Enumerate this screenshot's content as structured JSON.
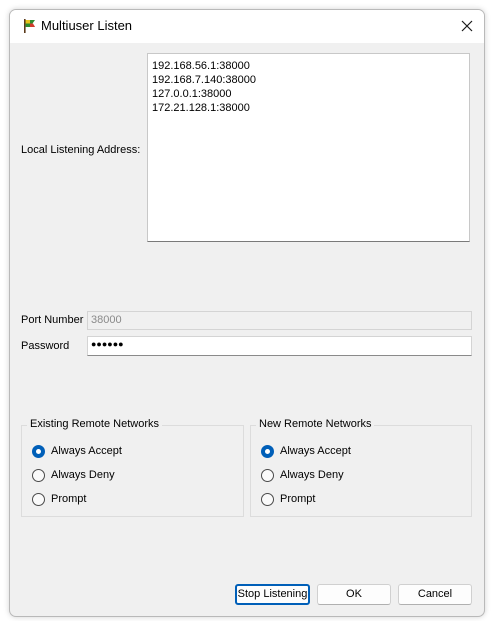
{
  "window": {
    "title": "Multiuser Listen"
  },
  "listen": {
    "address_label": "Local Listening Address:",
    "addresses": [
      "192.168.56.1:38000",
      "192.168.7.140:38000",
      "127.0.0.1:38000",
      "172.21.128.1:38000"
    ]
  },
  "port": {
    "label": "Port Number",
    "value": "38000"
  },
  "password": {
    "label": "Password",
    "masked_value": "●●●●●●"
  },
  "existing_networks": {
    "title": "Existing Remote Networks",
    "options": [
      "Always Accept",
      "Always Deny",
      "Prompt"
    ],
    "selected": "Always Accept"
  },
  "new_networks": {
    "title": "New Remote Networks",
    "options": [
      "Always Accept",
      "Always Deny",
      "Prompt"
    ],
    "selected": "Always Accept"
  },
  "buttons": {
    "stop_listening": "Stop Listening",
    "ok": "OK",
    "cancel": "Cancel"
  },
  "colors": {
    "accent": "#005fb8",
    "dialog_bg": "#f0f0f0"
  },
  "icons": {
    "app": "flag-icon",
    "close": "close-icon"
  }
}
